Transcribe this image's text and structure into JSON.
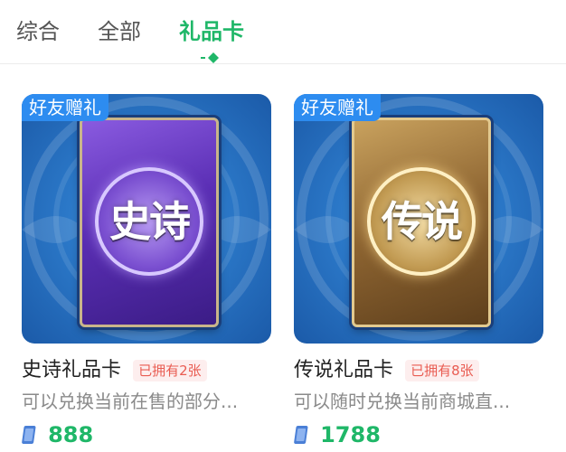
{
  "tabs": [
    {
      "label": "综合",
      "active": false
    },
    {
      "label": "全部",
      "active": false
    },
    {
      "label": "礼品卡",
      "active": true
    }
  ],
  "colors": {
    "accent": "#1fb768",
    "badge": "#2d8cf0",
    "owned_text": "#e95c52"
  },
  "cards": [
    {
      "badge": "好友赠礼",
      "emblem_text": "史诗",
      "title": "史诗礼品卡",
      "owned": "已拥有2张",
      "description": "可以兑换当前在售的部分...",
      "price_icon": "coupon-icon",
      "price": "888"
    },
    {
      "badge": "好友赠礼",
      "emblem_text": "传说",
      "title": "传说礼品卡",
      "owned": "已拥有8张",
      "description": "可以随时兑换当前商城直...",
      "price_icon": "coupon-icon",
      "price": "1788"
    }
  ]
}
